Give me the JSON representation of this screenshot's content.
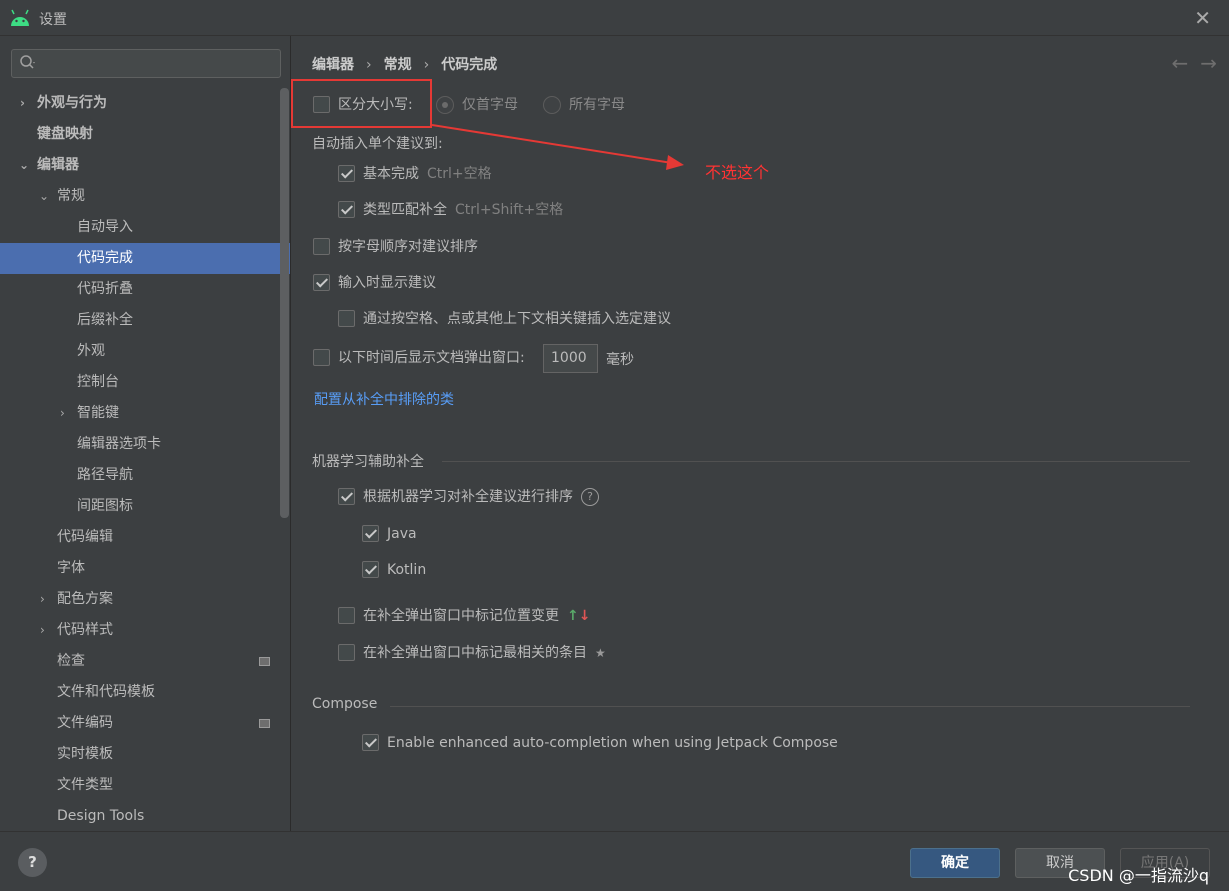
{
  "window": {
    "title": "设置"
  },
  "search": {
    "placeholder": ""
  },
  "sidebar": {
    "items": [
      {
        "label": "外观与行为",
        "arrow": "›"
      },
      {
        "label": "键盘映射",
        "arrow": ""
      },
      {
        "label": "编辑器",
        "arrow": "⌄"
      },
      {
        "label": "常规",
        "arrow": "⌄"
      },
      {
        "label": "自动导入",
        "arrow": ""
      },
      {
        "label": "代码完成",
        "arrow": ""
      },
      {
        "label": "代码折叠",
        "arrow": ""
      },
      {
        "label": "后缀补全",
        "arrow": ""
      },
      {
        "label": "外观",
        "arrow": ""
      },
      {
        "label": "控制台",
        "arrow": ""
      },
      {
        "label": "智能键",
        "arrow": "›"
      },
      {
        "label": "编辑器选项卡",
        "arrow": ""
      },
      {
        "label": "路径导航",
        "arrow": ""
      },
      {
        "label": "间距图标",
        "arrow": ""
      },
      {
        "label": "代码编辑",
        "arrow": ""
      },
      {
        "label": "字体",
        "arrow": ""
      },
      {
        "label": "配色方案",
        "arrow": "›"
      },
      {
        "label": "代码样式",
        "arrow": "›"
      },
      {
        "label": "检查",
        "arrow": ""
      },
      {
        "label": "文件和代码模板",
        "arrow": ""
      },
      {
        "label": "文件编码",
        "arrow": ""
      },
      {
        "label": "实时模板",
        "arrow": ""
      },
      {
        "label": "文件类型",
        "arrow": ""
      },
      {
        "label": "Design Tools",
        "arrow": ""
      }
    ]
  },
  "breadcrumb": {
    "part1": "编辑器",
    "part2": "常规",
    "part3": "代码完成",
    "sep": "›"
  },
  "nav": {
    "back": "←",
    "forward": "→"
  },
  "options": {
    "case_sensitive": {
      "label": "区分大小写:",
      "checked": false
    },
    "radio_first": {
      "label": "仅首字母",
      "selected": true
    },
    "radio_all": {
      "label": "所有字母",
      "selected": false
    },
    "auto_insert_heading": "自动插入单个建议到:",
    "basic": {
      "label": "基本完成",
      "hint": "Ctrl+空格",
      "checked": true
    },
    "type_match": {
      "label": "类型匹配补全",
      "hint": "Ctrl+Shift+空格",
      "checked": true
    },
    "alpha_sort": {
      "label": "按字母顺序对建议排序",
      "checked": false
    },
    "show_on_type": {
      "label": "输入时显示建议",
      "checked": true
    },
    "insert_by_key": {
      "label": "通过按空格、点或其他上下文相关键插入选定建议",
      "checked": false
    },
    "doc_popup": {
      "label": "以下时间后显示文档弹出窗口:",
      "value": "1000",
      "unit": "毫秒",
      "checked": false
    },
    "exclude_link": "配置从补全中排除的类"
  },
  "ml": {
    "title": "机器学习辅助补全",
    "sort": {
      "label": "根据机器学习对补全建议进行排序",
      "checked": true
    },
    "help": "?",
    "java": {
      "label": "Java",
      "checked": true
    },
    "kotlin": {
      "label": "Kotlin",
      "checked": true
    },
    "mark_pos": {
      "label": "在补全弹出窗口中标记位置变更",
      "checked": false,
      "up": "↑",
      "down": "↓"
    },
    "mark_rel": {
      "label": "在补全弹出窗口中标记最相关的条目",
      "checked": false,
      "star": "★"
    }
  },
  "compose": {
    "title": "Compose",
    "enhanced": {
      "label": "Enable enhanced auto-completion when using Jetpack Compose",
      "checked": true
    }
  },
  "annotation": {
    "note": "不选这个"
  },
  "footer": {
    "help": "?",
    "ok": "确定",
    "cancel": "取消",
    "apply": "应用(A)",
    "watermark": "CSDN @一指流沙q"
  },
  "colors": {
    "accent": "#4b6eaf",
    "primary_button": "#365880",
    "link": "#589df6",
    "annotation": "#e53935"
  }
}
